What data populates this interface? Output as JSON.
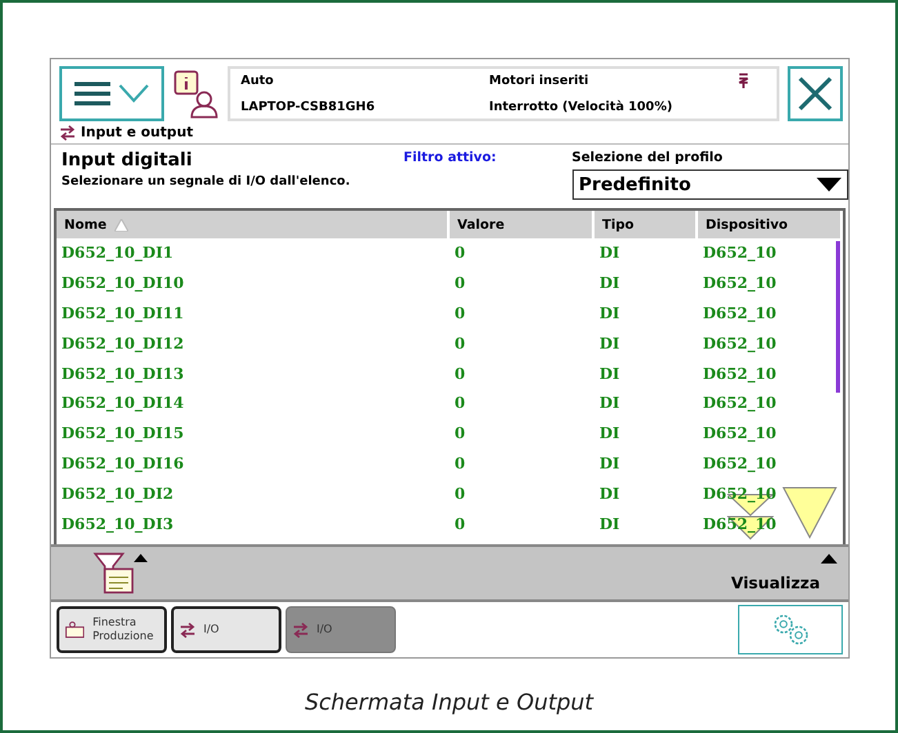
{
  "status": {
    "mode": "Auto",
    "system": "LAPTOP-CSB81GH6",
    "motors": "Motori inseriti",
    "state": "Interrotto (Velocità 100%)"
  },
  "breadcrumb": "Input e output",
  "view": {
    "title": "Input digitali",
    "instruction": "Selezionare un segnale di I/O dall'elenco.",
    "filter_label": "Filtro attivo:",
    "profile_label": "Selezione del profilo",
    "profile_value": "Predefinito"
  },
  "table": {
    "columns": [
      {
        "label": "Nome",
        "sorted": true
      },
      {
        "label": "Valore",
        "sorted": false
      },
      {
        "label": "Tipo",
        "sorted": false
      },
      {
        "label": "Dispositivo",
        "sorted": false
      }
    ],
    "rows": [
      [
        "D652_10_DI1",
        "0",
        "DI",
        "D652_10"
      ],
      [
        "D652_10_DI10",
        "0",
        "DI",
        "D652_10"
      ],
      [
        "D652_10_DI11",
        "0",
        "DI",
        "D652_10"
      ],
      [
        "D652_10_DI12",
        "0",
        "DI",
        "D652_10"
      ],
      [
        "D652_10_DI13",
        "0",
        "DI",
        "D652_10"
      ],
      [
        "D652_10_DI14",
        "0",
        "DI",
        "D652_10"
      ],
      [
        "D652_10_DI15",
        "0",
        "DI",
        "D652_10"
      ],
      [
        "D652_10_DI16",
        "0",
        "DI",
        "D652_10"
      ],
      [
        "D652_10_DI2",
        "0",
        "DI",
        "D652_10"
      ],
      [
        "D652_10_DI3",
        "0",
        "DI",
        "D652_10"
      ]
    ]
  },
  "toolbar": {
    "view_menu": "Visualizza"
  },
  "taskbar": [
    {
      "kind": "production",
      "label": "Finestra Produzione",
      "selected": false
    },
    {
      "kind": "io",
      "label": "I/O",
      "selected": false
    },
    {
      "kind": "io",
      "label": "I/O",
      "selected": true
    }
  ],
  "caption": "Schermata Input e Output"
}
